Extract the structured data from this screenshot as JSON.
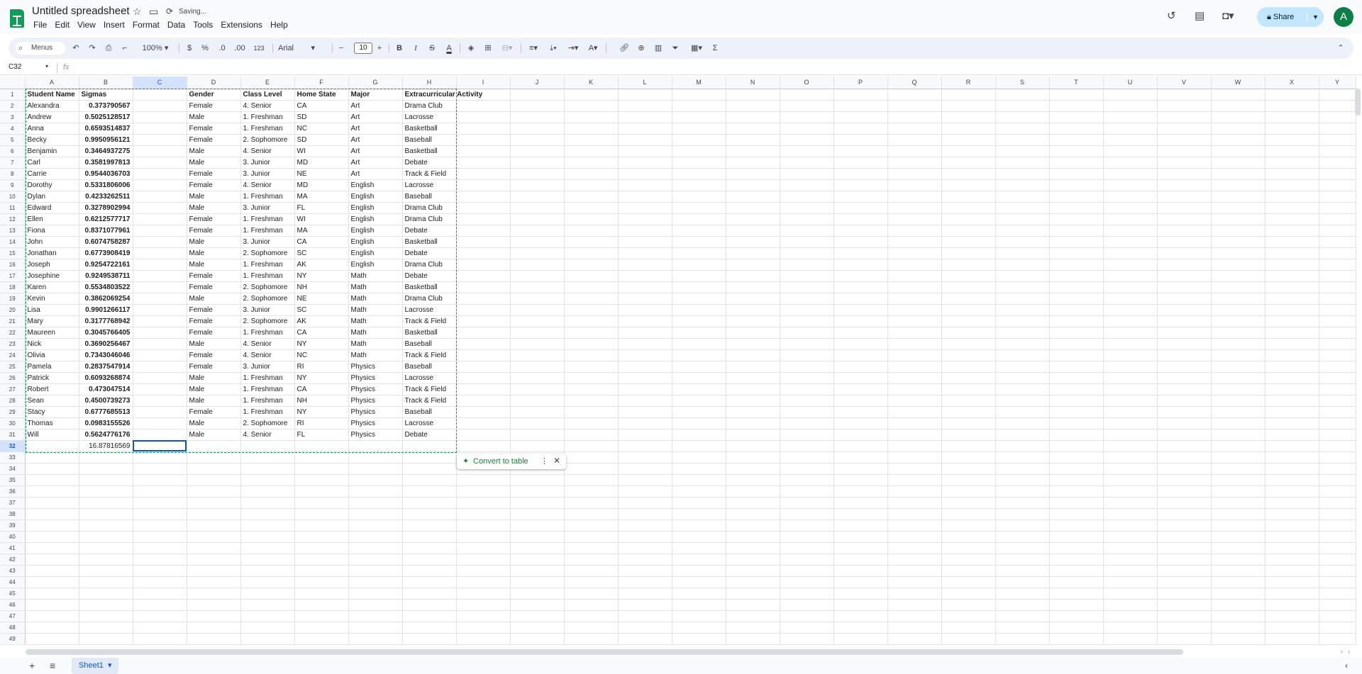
{
  "app": {
    "title": "Untitled spreadsheet",
    "status": "Saving...",
    "share_label": "Share",
    "avatar_letter": "A"
  },
  "menu": [
    "File",
    "Edit",
    "View",
    "Insert",
    "Format",
    "Data",
    "Tools",
    "Extensions",
    "Help"
  ],
  "toolbar": {
    "menus_label": "Menus",
    "zoom": "100%",
    "currency": "$",
    "percent": "%",
    "dec_dec": ".0",
    "inc_dec": ".00",
    "number_format": "123",
    "font": "Arial",
    "font_size": "10",
    "minus": "−",
    "plus": "+"
  },
  "formula_bar": {
    "name_box": "C32",
    "fx": "fx",
    "value": ""
  },
  "columns": [
    "A",
    "B",
    "C",
    "D",
    "E",
    "F",
    "G",
    "H",
    "I",
    "J",
    "K",
    "L",
    "M",
    "N",
    "O",
    "P",
    "Q",
    "R",
    "S",
    "T",
    "U",
    "V",
    "W",
    "X",
    "Y"
  ],
  "headers": [
    "Student Name",
    "Sigmas",
    "",
    "Gender",
    "Class Level",
    "Home State",
    "Major",
    "Extracurricular Activity"
  ],
  "rows": [
    [
      "Alexandra",
      "0.373790567",
      "",
      "Female",
      "4. Senior",
      "CA",
      "Art",
      "Drama Club"
    ],
    [
      "Andrew",
      "0.5025128517",
      "",
      "Male",
      "1. Freshman",
      "SD",
      "Art",
      "Lacrosse"
    ],
    [
      "Anna",
      "0.6593514837",
      "",
      "Female",
      "1. Freshman",
      "NC",
      "Art",
      "Basketball"
    ],
    [
      "Becky",
      "0.9950956121",
      "",
      "Female",
      "2. Sophomore",
      "SD",
      "Art",
      "Baseball"
    ],
    [
      "Benjamin",
      "0.3464937275",
      "",
      "Male",
      "4. Senior",
      "WI",
      "Art",
      "Basketball"
    ],
    [
      "Carl",
      "0.3581997813",
      "",
      "Male",
      "3. Junior",
      "MD",
      "Art",
      "Debate"
    ],
    [
      "Carrie",
      "0.9544036703",
      "",
      "Female",
      "3. Junior",
      "NE",
      "Art",
      "Track & Field"
    ],
    [
      "Dorothy",
      "0.5331806006",
      "",
      "Female",
      "4. Senior",
      "MD",
      "English",
      "Lacrosse"
    ],
    [
      "Dylan",
      "0.4233262511",
      "",
      "Male",
      "1. Freshman",
      "MA",
      "English",
      "Baseball"
    ],
    [
      "Edward",
      "0.3278902994",
      "",
      "Male",
      "3. Junior",
      "FL",
      "English",
      "Drama Club"
    ],
    [
      "Ellen",
      "0.6212577717",
      "",
      "Female",
      "1. Freshman",
      "WI",
      "English",
      "Drama Club"
    ],
    [
      "Fiona",
      "0.8371077961",
      "",
      "Female",
      "1. Freshman",
      "MA",
      "English",
      "Debate"
    ],
    [
      "John",
      "0.6074758287",
      "",
      "Male",
      "3. Junior",
      "CA",
      "English",
      "Basketball"
    ],
    [
      "Jonathan",
      "0.6773908419",
      "",
      "Male",
      "2. Sophomore",
      "SC",
      "English",
      "Debate"
    ],
    [
      "Joseph",
      "0.9254722161",
      "",
      "Male",
      "1. Freshman",
      "AK",
      "English",
      "Drama Club"
    ],
    [
      "Josephine",
      "0.9249538711",
      "",
      "Female",
      "1. Freshman",
      "NY",
      "Math",
      "Debate"
    ],
    [
      "Karen",
      "0.5534803522",
      "",
      "Female",
      "2. Sophomore",
      "NH",
      "Math",
      "Basketball"
    ],
    [
      "Kevin",
      "0.3862069254",
      "",
      "Male",
      "2. Sophomore",
      "NE",
      "Math",
      "Drama Club"
    ],
    [
      "Lisa",
      "0.9901266117",
      "",
      "Female",
      "3. Junior",
      "SC",
      "Math",
      "Lacrosse"
    ],
    [
      "Mary",
      "0.3177768942",
      "",
      "Female",
      "2. Sophomore",
      "AK",
      "Math",
      "Track & Field"
    ],
    [
      "Maureen",
      "0.3045766405",
      "",
      "Female",
      "1. Freshman",
      "CA",
      "Math",
      "Basketball"
    ],
    [
      "Nick",
      "0.3690256467",
      "",
      "Male",
      "4. Senior",
      "NY",
      "Math",
      "Baseball"
    ],
    [
      "Olivia",
      "0.7343046046",
      "",
      "Female",
      "4. Senior",
      "NC",
      "Math",
      "Track & Field"
    ],
    [
      "Pamela",
      "0.2837547914",
      "",
      "Female",
      "3. Junior",
      "RI",
      "Physics",
      "Baseball"
    ],
    [
      "Patrick",
      "0.6093268874",
      "",
      "Male",
      "1. Freshman",
      "NY",
      "Physics",
      "Lacrosse"
    ],
    [
      "Robert",
      "0.473047514",
      "",
      "Male",
      "1. Freshman",
      "CA",
      "Physics",
      "Track & Field"
    ],
    [
      "Sean",
      "0.4500739273",
      "",
      "Male",
      "1. Freshman",
      "NH",
      "Physics",
      "Track & Field"
    ],
    [
      "Stacy",
      "0.6777685513",
      "",
      "Female",
      "1. Freshman",
      "NY",
      "Physics",
      "Baseball"
    ],
    [
      "Thomas",
      "0.0983155526",
      "",
      "Male",
      "2. Sophomore",
      "RI",
      "Physics",
      "Lacrosse"
    ],
    [
      "Will",
      "0.5624776176",
      "",
      "Male",
      "4. Senior",
      "FL",
      "Physics",
      "Debate"
    ]
  ],
  "total_row": [
    "",
    "16.87816569",
    "",
    "",
    "",
    "",
    "",
    ""
  ],
  "row_count": 49,
  "convert_label": "Convert to table",
  "sheet_tab": "Sheet1"
}
